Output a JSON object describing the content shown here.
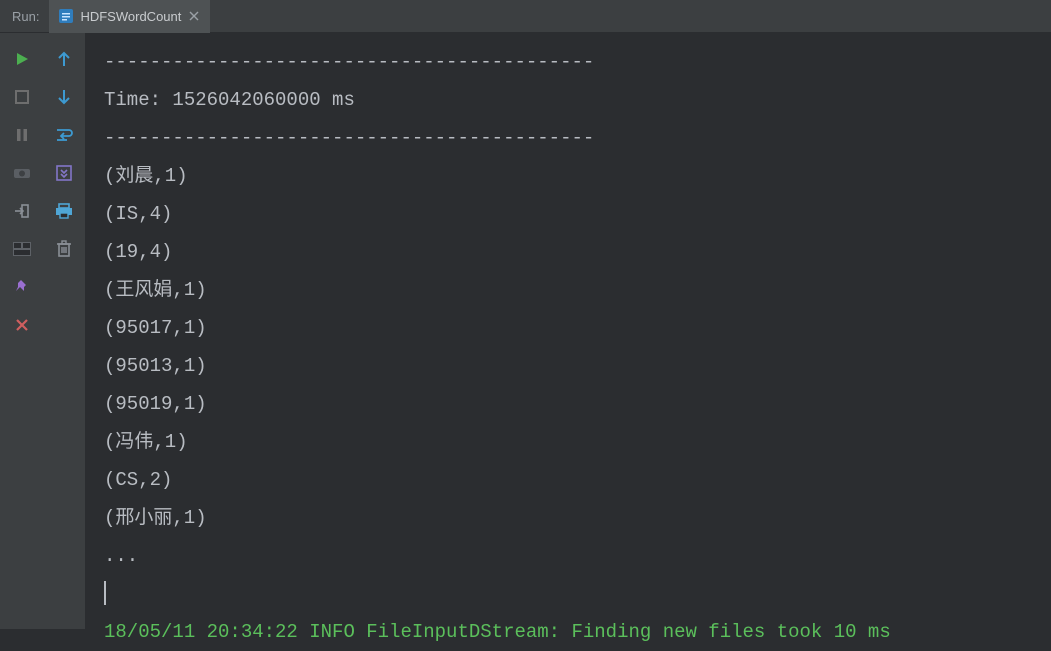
{
  "header": {
    "run_label": "Run:",
    "tab_name": "HDFSWordCount"
  },
  "console": {
    "sep_top": "-------------------------------------------",
    "time_line": "Time: 1526042060000 ms",
    "sep_bot": "-------------------------------------------",
    "rows": [
      "(刘晨,1)",
      "(IS,4)",
      "(19,4)",
      "(王风娟,1)",
      "(95017,1)",
      "(95013,1)",
      "(95019,1)",
      "(冯伟,1)",
      "(CS,2)",
      "(邢小丽,1)"
    ],
    "ellipsis": "...",
    "info": "18/05/11 20:34:22 INFO FileInputDStream: Finding new files took 10 ms"
  }
}
